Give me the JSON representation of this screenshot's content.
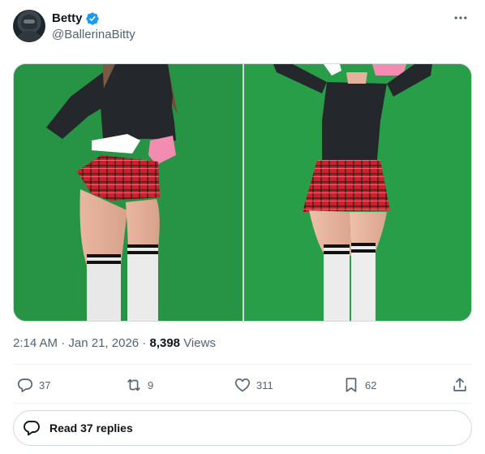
{
  "author": {
    "display_name": "Betty",
    "handle": "@BallerinaBitty",
    "verified": true,
    "avatar_icon": "avatar-helmet-photo"
  },
  "media": {
    "photos": [
      {
        "subject": "photo-left"
      },
      {
        "subject": "photo-right"
      }
    ]
  },
  "meta": {
    "time": "2:14 AM",
    "separator": " · ",
    "date": "Jan 21, 2026",
    "views_count": "8,398",
    "views_label": " Views"
  },
  "actions": {
    "reply_count": "37",
    "repost_count": "9",
    "like_count": "311",
    "bookmark_count": "62"
  },
  "read_replies": {
    "label": "Read 37 replies"
  },
  "colors": {
    "text": "#0f1419",
    "secondary": "#536471",
    "border": "#cfd9de",
    "verified": "#1d9bf0",
    "greenscreen": "#2ea04c",
    "skirt": "#c8232c"
  }
}
